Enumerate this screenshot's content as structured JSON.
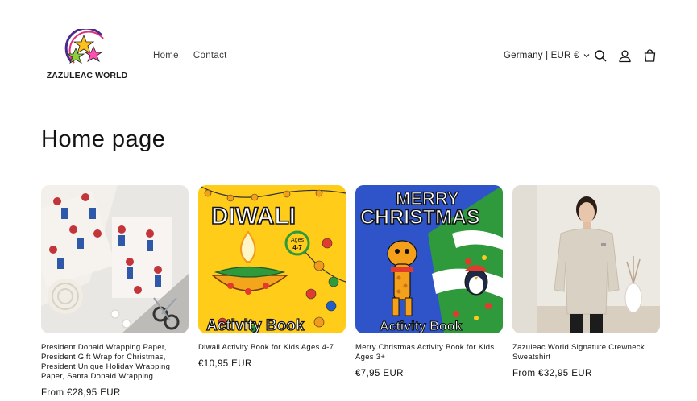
{
  "header": {
    "logo_text": "ZAZULEAC WORLD",
    "nav": [
      {
        "label": "Home"
      },
      {
        "label": "Contact"
      }
    ],
    "country_selector": "Germany | EUR €",
    "icons": [
      "search-icon",
      "account-icon",
      "cart-icon"
    ]
  },
  "main": {
    "title": "Home page",
    "products": [
      {
        "title": "President Donald Wrapping Paper, President Gift Wrap for Christmas, President Unique Holiday Wrapping Paper, Santa Donald Wrapping",
        "price": "From €28,95 EUR"
      },
      {
        "title": "Diwali Activity Book for Kids Ages 4-7",
        "price": "€10,95 EUR",
        "image_text": {
          "line1": "DIWALI",
          "line2": "Activity Book",
          "badge_top": "Ages",
          "badge_bottom": "4-7"
        }
      },
      {
        "title": "Merry Christmas Activity Book for Kids Ages 3+",
        "price": "€7,95 EUR",
        "image_text": {
          "line1": "MERRY",
          "line2": "CHRISTMAS",
          "line3": "Activity Book"
        }
      },
      {
        "title": "Zazuleac World Signature Crewneck Sweatshirt",
        "price": "From €32,95 EUR"
      }
    ]
  },
  "colors": {
    "text": "#121212",
    "diwali_bg": "#ffcc1a",
    "xmas_bg": "#2f54c9",
    "sweatshirt": "#d9d2c4"
  }
}
